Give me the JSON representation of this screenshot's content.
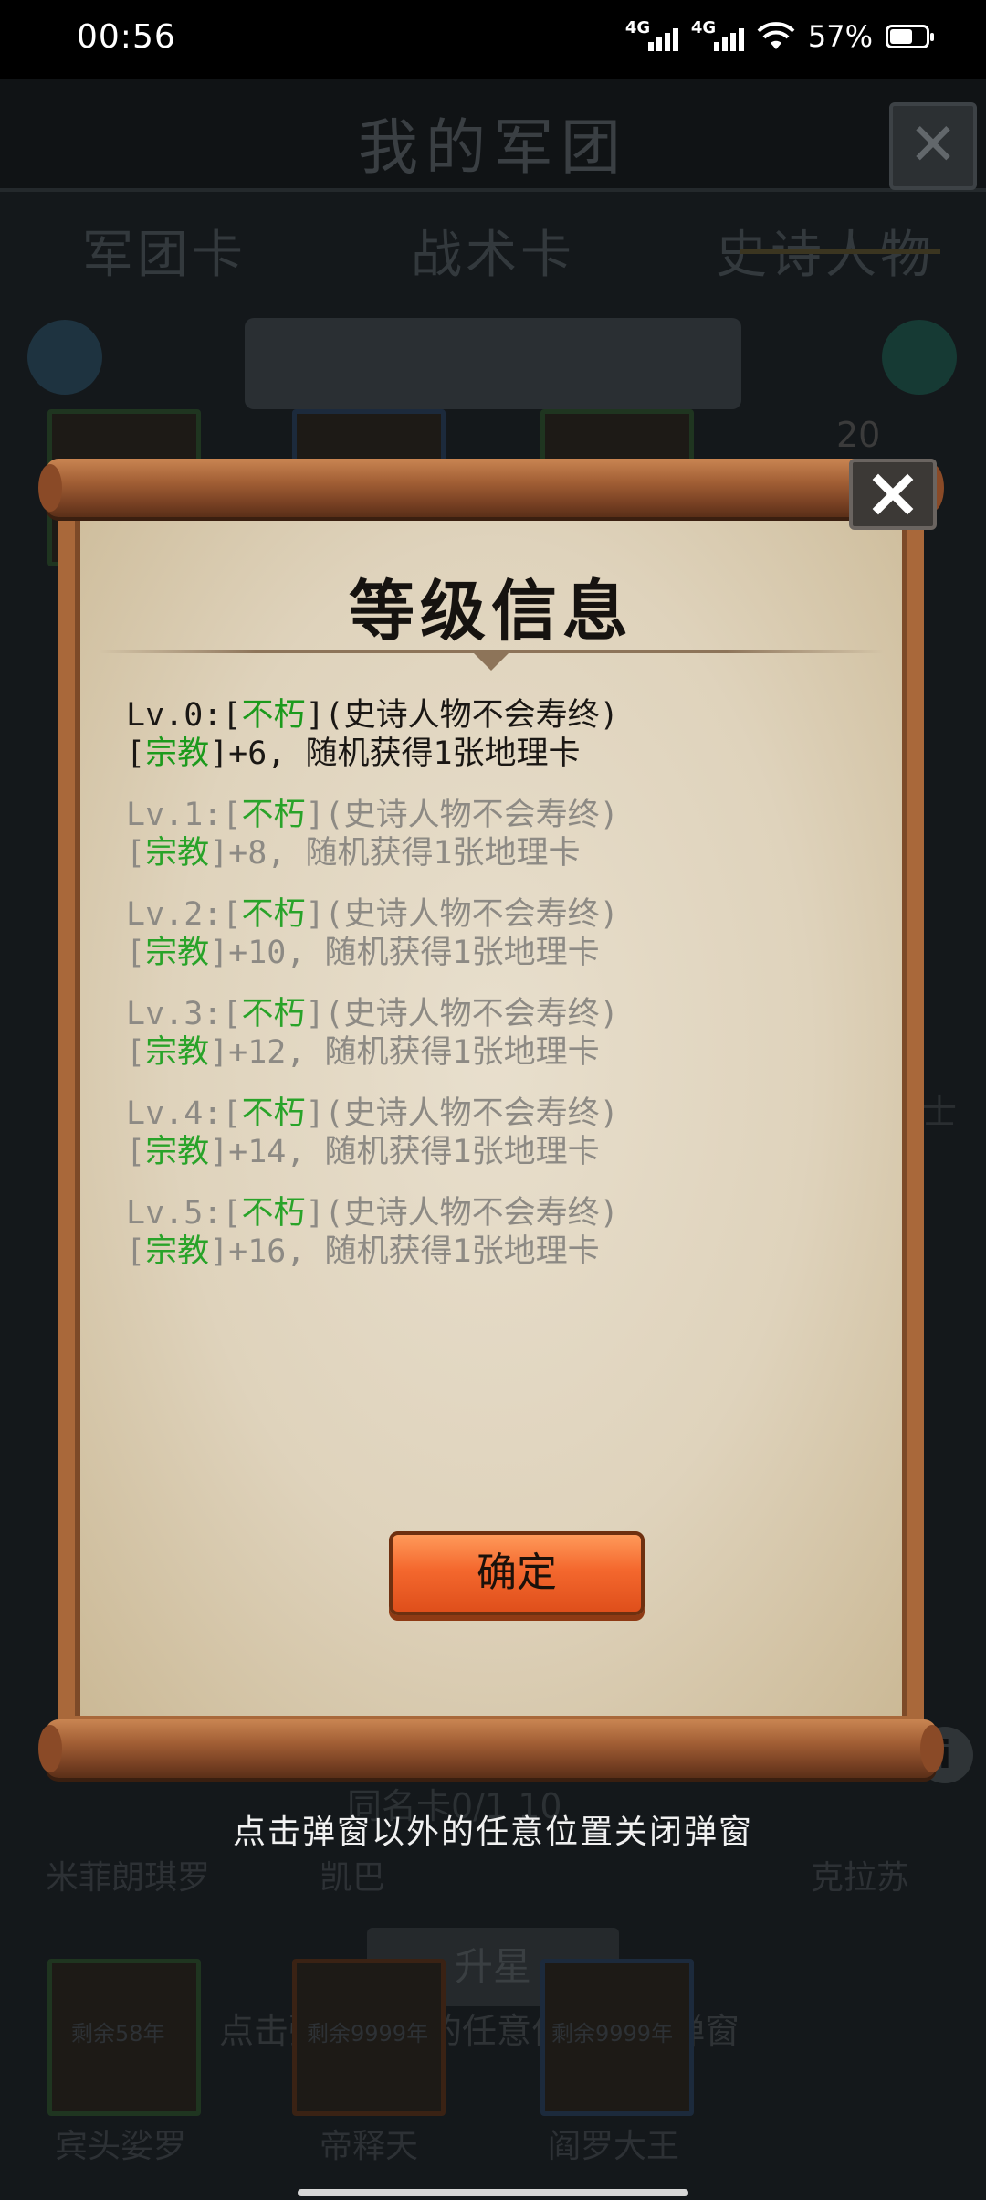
{
  "status_bar": {
    "time": "00:56",
    "network1": "4G",
    "network2": "4G",
    "battery": "57%",
    "battery_level": 0.57
  },
  "background": {
    "title": "我的军团",
    "tabs": [
      "军团卡",
      "战术卡",
      "史诗人物"
    ],
    "top_card_count": "20",
    "side_text_right": "士",
    "rank_text": "同名卡0/1 10",
    "upgrade_label": "升星",
    "bottom_names_row1": [
      "米菲朗琪罗",
      "凯巴",
      "克拉苏"
    ],
    "cards_bottom": [
      {
        "name": "宾头娑罗",
        "remaining": "剩余58年"
      },
      {
        "name": "帝释天",
        "remaining": "剩余9999年"
      },
      {
        "name": "阎罗大王",
        "remaining": "剩余9999年"
      }
    ],
    "hint_shadow": "点击弹窗以外的任意位置关闭弹窗"
  },
  "modal": {
    "title": "等级信息",
    "levels": [
      {
        "prefix": "Lv.0:[",
        "trait": "不朽",
        "trait_suffix": "](史诗人物不会寿终)",
        "line2_prefix": "[",
        "stat": "宗教",
        "line2_suffix": "]+6, 随机获得1张地理卡"
      },
      {
        "prefix": "Lv.1:[",
        "trait": "不朽",
        "trait_suffix": "](史诗人物不会寿终)",
        "line2_prefix": "[",
        "stat": "宗教",
        "line2_suffix": "]+8, 随机获得1张地理卡"
      },
      {
        "prefix": "Lv.2:[",
        "trait": "不朽",
        "trait_suffix": "](史诗人物不会寿终)",
        "line2_prefix": "[",
        "stat": "宗教",
        "line2_suffix": "]+10, 随机获得1张地理卡"
      },
      {
        "prefix": "Lv.3:[",
        "trait": "不朽",
        "trait_suffix": "](史诗人物不会寿终)",
        "line2_prefix": "[",
        "stat": "宗教",
        "line2_suffix": "]+12, 随机获得1张地理卡"
      },
      {
        "prefix": "Lv.4:[",
        "trait": "不朽",
        "trait_suffix": "](史诗人物不会寿终)",
        "line2_prefix": "[",
        "stat": "宗教",
        "line2_suffix": "]+14, 随机获得1张地理卡"
      },
      {
        "prefix": "Lv.5:[",
        "trait": "不朽",
        "trait_suffix": "](史诗人物不会寿终)",
        "line2_prefix": "[",
        "stat": "宗教",
        "line2_suffix": "]+16, 随机获得1张地理卡"
      }
    ],
    "confirm_label": "确定"
  },
  "hint": "点击弹窗以外的任意位置关闭弹窗",
  "colors": {
    "trait_green": "#1c9a1c",
    "button_orange": "#f4682e",
    "paper": "#e2d8c4"
  }
}
